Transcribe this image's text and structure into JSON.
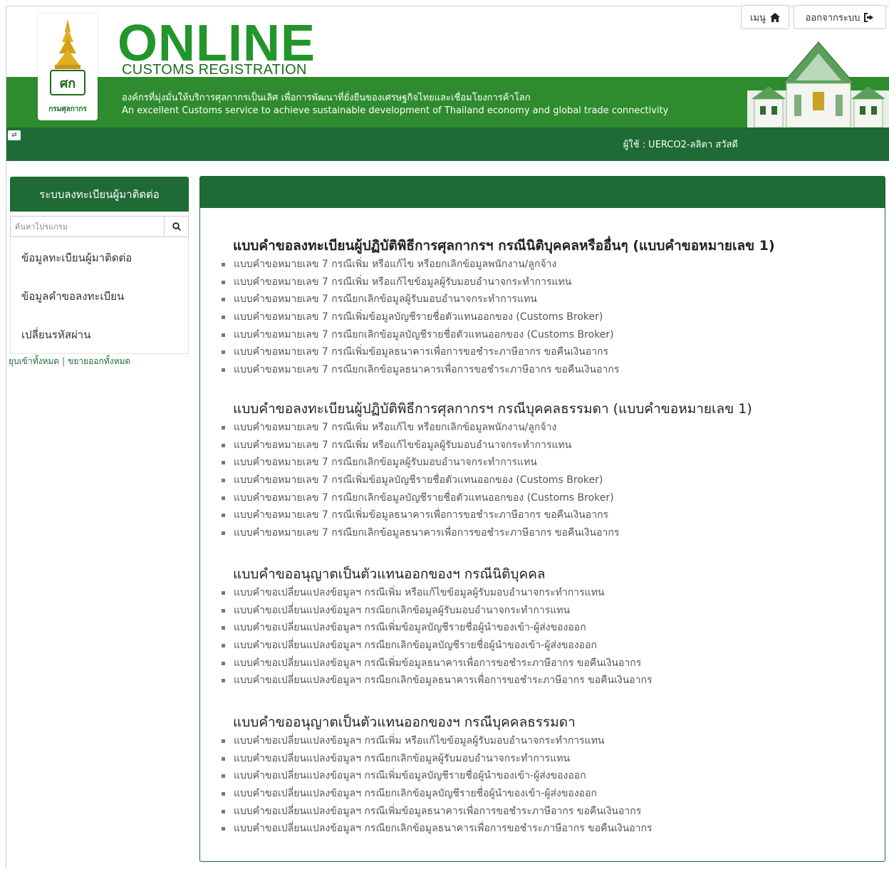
{
  "banner": {
    "logo_caption": "กรมศุลกากร",
    "title": "ONLINE",
    "subtitle": "CUSTOMS REGISTRATION",
    "tagline_th": "องค์กรที่มุ่งมั่นให้บริการศุลกากรเป็นเลิศ เพื่อการพัฒนาที่ยั่งยืนของเศรษฐกิจไทยและเชื่อมโยงการค้าโลก",
    "tagline_en": "An excellent Customs service to achieve sustainable development of Thailand economy and global trade connectivity"
  },
  "navbar": {
    "user_label": "ผู้ใช้ : UERCO2-ลลิตา สวัสดี",
    "menu_label": "เมนู",
    "logout_label": "ออกจากระบบ"
  },
  "sidebar": {
    "title": "ระบบลงทะเบียนผู้มาติดต่อ",
    "search_placeholder": "ค้นหาโปรแกรม",
    "items": [
      "ข้อมูลทะเบียนผู้มาติดต่อ",
      "ข้อมูลคำขอลงทะเบียน",
      "เปลี่ยนรหัสผ่าน"
    ],
    "collapse_all": "ยุบเข้าทั้งหมด",
    "expand_all": "ขยายออกทั้งหมด",
    "separator": "|"
  },
  "sections": [
    {
      "title": "แบบคำขอลงทะเบียนผู้ปฏิบัติพิธีการศุลกากรฯ กรณีนิติบุคคลหรืออื่นๆ (แบบคำขอหมายเลข 1)",
      "items": [
        "แบบคำขอหมายเลข 7 กรณีเพิ่ม หรือแก้ไข หรือยกเลิกข้อมูลพนักงาน/ลูกจ้าง",
        "แบบคำขอหมายเลข 7 กรณีเพิ่ม หรือแก้ไขข้อมูลผู้รับมอบอำนาจกระทำการแทน",
        "แบบคำขอหมายเลข 7 กรณียกเลิกข้อมูลผู้รับมอบอำนาจกระทำการแทน",
        "แบบคำขอหมายเลข 7 กรณีเพิ่มข้อมูลบัญชีรายชื่อตัวแทนออกของ (Customs Broker)",
        "แบบคำขอหมายเลข 7 กรณียกเลิกข้อมูลบัญชีรายชื่อตัวแทนออกของ (Customs Broker)",
        "แบบคำขอหมายเลข 7 กรณีเพิ่มข้อมูลธนาคารเพื่อการขอชำระภาษีอากร ขอคืนเงินอากร",
        "แบบคำขอหมายเลข 7 กรณียกเลิกข้อมูลธนาคารเพื่อการขอชำระภาษีอากร ขอคืนเงินอากร"
      ]
    },
    {
      "title": "แบบคำขอลงทะเบียนผู้ปฏิบัติพิธีการศุลกากรฯ กรณีบุคคลธรรมดา (แบบคำขอหมายเลข 1)",
      "items": [
        "แบบคำขอหมายเลข 7 กรณีเพิ่ม หรือแก้ไข หรือยกเลิกข้อมูลพนักงาน/ลูกจ้าง",
        "แบบคำขอหมายเลข 7 กรณีเพิ่ม หรือแก้ไขข้อมูลผู้รับมอบอำนาจกระทำการแทน",
        "แบบคำขอหมายเลข 7 กรณียกเลิกข้อมูลผู้รับมอบอำนาจกระทำการแทน",
        "แบบคำขอหมายเลข 7 กรณีเพิ่มข้อมูลบัญชีรายชื่อตัวแทนออกของ (Customs Broker)",
        "แบบคำขอหมายเลข 7 กรณียกเลิกข้อมูลบัญชีรายชื่อตัวแทนออกของ (Customs Broker)",
        "แบบคำขอหมายเลข 7 กรณีเพิ่มข้อมูลธนาคารเพื่อการขอชำระภาษีอากร ขอคืนเงินอากร",
        "แบบคำขอหมายเลข 7 กรณียกเลิกข้อมูลธนาคารเพื่อการขอชำระภาษีอากร ขอคืนเงินอากร"
      ]
    },
    {
      "title": "แบบคำขออนุญาตเป็นตัวแทนออกของฯ กรณีนิติบุคคล",
      "items": [
        "แบบคำขอเปลี่ยนแปลงข้อมูลฯ กรณีเพิ่ม หรือแก้ไขข้อมูลผู้รับมอบอำนาจกระทำการแทน",
        "แบบคำขอเปลี่ยนแปลงข้อมูลฯ กรณียกเลิกข้อมูลผู้รับมอบอำนาจกระทำการแทน",
        "แบบคำขอเปลี่ยนแปลงข้อมูลฯ กรณีเพิ่มข้อมูลบัญชีรายชื่อผู้นำของเข้า-ผู้ส่งของออก",
        "แบบคำขอเปลี่ยนแปลงข้อมูลฯ กรณียกเลิกข้อมูลบัญชีรายชื่อผู้นำของเข้า-ผู้ส่งของออก",
        "แบบคำขอเปลี่ยนแปลงข้อมูลฯ กรณีเพิ่มข้อมูลธนาคารเพื่อการขอชำระภาษีอากร ขอคืนเงินอากร",
        "แบบคำขอเปลี่ยนแปลงข้อมูลฯ กรณียกเลิกข้อมูลธนาคารเพื่อการขอชำระภาษีอากร ขอคืนเงินอากร"
      ]
    },
    {
      "title": "แบบคำขออนุญาตเป็นตัวแทนออกของฯ กรณีบุคคลธรรมดา",
      "items": [
        "แบบคำขอเปลี่ยนแปลงข้อมูลฯ กรณีเพิ่ม หรือแก้ไขข้อมูลผู้รับมอบอำนาจกระทำการแทน",
        "แบบคำขอเปลี่ยนแปลงข้อมูลฯ กรณียกเลิกข้อมูลผู้รับมอบอำนาจกระทำการแทน",
        "แบบคำขอเปลี่ยนแปลงข้อมูลฯ กรณีเพิ่มข้อมูลบัญชีรายชื่อผู้นำของเข้า-ผู้ส่งของออก",
        "แบบคำขอเปลี่ยนแปลงข้อมูลฯ กรณียกเลิกข้อมูลบัญชีรายชื่อผู้นำของเข้า-ผู้ส่งของออก",
        "แบบคำขอเปลี่ยนแปลงข้อมูลฯ กรณีเพิ่มข้อมูลธนาคารเพื่อการขอชำระภาษีอากร ขอคืนเงินอากร",
        "แบบคำขอเปลี่ยนแปลงข้อมูลฯ กรณียกเลิกข้อมูลธนาคารเพื่อการขอชำระภาษีอากร ขอคืนเงินอากร"
      ]
    }
  ],
  "colors": {
    "primary_green": "#1e6b35",
    "banner_green": "#2e8b2e",
    "brand_green": "#22962a"
  },
  "icons": {
    "menu": "home-icon",
    "logout": "sign-out-icon",
    "search": "search-icon",
    "toggle": "sidebar-toggle-icon"
  }
}
